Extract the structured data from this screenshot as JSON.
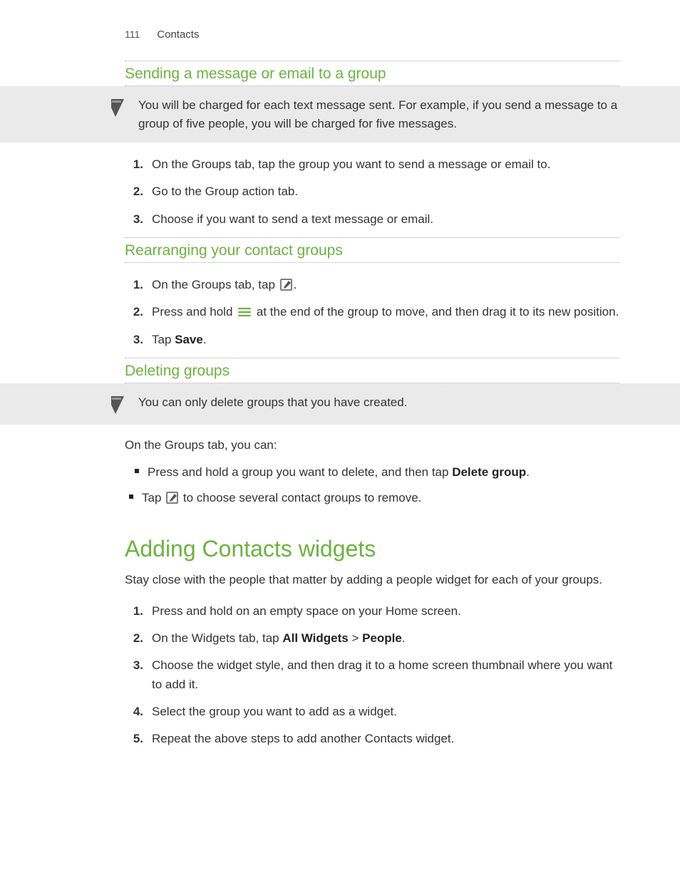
{
  "header": {
    "pageno": "111",
    "section": "Contacts"
  },
  "sec1": {
    "title": "Sending a message or email to a group",
    "note": "You will be charged for each text message sent. For example, if you send a message to a group of five people, you will be charged for five messages.",
    "steps": {
      "n1": "1.",
      "t1": "On the Groups tab, tap the group you want to send a message or email to.",
      "n2": "2.",
      "t2": "Go to the Group action tab.",
      "n3": "3.",
      "t3": "Choose if you want to send a text message or email."
    }
  },
  "sec2": {
    "title": "Rearranging your contact groups",
    "steps": {
      "n1": "1.",
      "t1a": "On the Groups tab, tap ",
      "t1b": ".",
      "n2": "2.",
      "t2a": "Press and hold ",
      "t2b": " at the end of the group to move, and then drag it to its new position.",
      "n3": "3.",
      "t3a": "Tap ",
      "t3b": "Save",
      "t3c": "."
    }
  },
  "sec3": {
    "title": "Deleting groups",
    "note": "You can only delete groups that you have created.",
    "lead": "On the Groups tab, you can:",
    "bullets": {
      "b1a": "Press and hold a group you want to delete, and then tap ",
      "b1b": "Delete group",
      "b1c": ".",
      "b2a": "Tap ",
      "b2b": " to choose several contact groups to remove."
    }
  },
  "sec4": {
    "title": "Adding Contacts widgets",
    "lead": "Stay close with the people that matter by adding a people widget for each of your groups.",
    "steps": {
      "n1": "1.",
      "t1": "Press and hold on an empty space on your Home screen.",
      "n2": "2.",
      "t2a": "On the Widgets tab, tap ",
      "t2b": "All Widgets",
      "t2c": " > ",
      "t2d": "People",
      "t2e": ".",
      "n3": "3.",
      "t3": "Choose the widget style, and then drag it to a home screen thumbnail where you want to add it.",
      "n4": "4.",
      "t4": "Select the group you want to add as a widget.",
      "n5": "5.",
      "t5": "Repeat the above steps to add another Contacts widget."
    }
  }
}
